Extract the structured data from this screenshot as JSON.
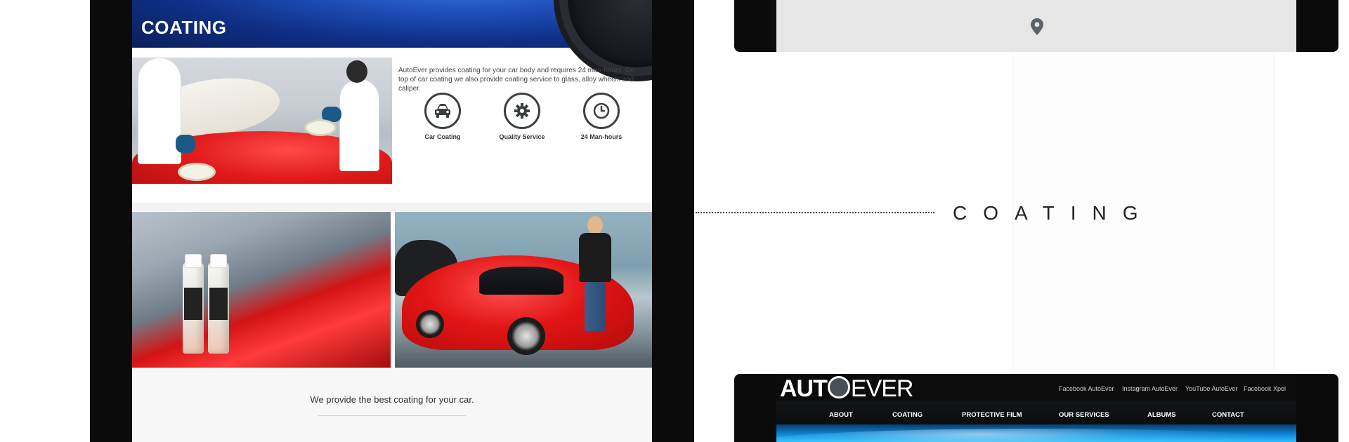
{
  "section": {
    "hero_title": "COATING",
    "intro_text": "AutoEver provides coating for your car body and requires 24 man-hours. On top of car coating we also provide coating service to glass, alloy wheels and caliper.",
    "features": [
      {
        "label": "Car Coating",
        "icon": "car-icon"
      },
      {
        "label": "Quality Service",
        "icon": "gear-icon"
      },
      {
        "label": "24 Man-hours",
        "icon": "clock-icon"
      }
    ],
    "tagline": "We provide the best coating for your car."
  },
  "center_label": "COATING",
  "map": {
    "icon": "map-pin-icon"
  },
  "site_header": {
    "logo": {
      "bold": "AUT",
      "rest": "EVER"
    },
    "top_links": [
      "Facebook AutoEver",
      "Instagram AutoEver",
      "YouTube AutoEver",
      "Facebook Xpel"
    ],
    "nav": [
      "ABOUT",
      "COATING",
      "PROTECTIVE FILM",
      "OUR SERVICES",
      "ALBUMS",
      "CONTACT"
    ]
  },
  "colors": {
    "accent_blue": "#1e4fb8",
    "dark_frame": "#0b0b0b",
    "icon_gray": "#3a3f44"
  }
}
